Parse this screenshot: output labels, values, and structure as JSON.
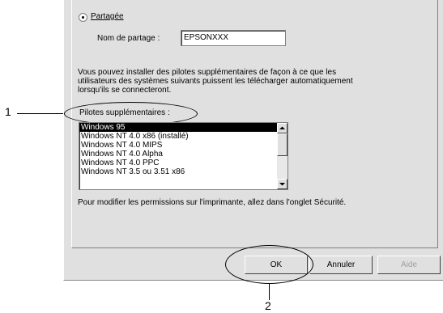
{
  "sharing": {
    "radio_label": "Partagée",
    "share_name_label": "Nom de partage :",
    "share_name_value": "EPSONXXX"
  },
  "info_text": {
    "line1": "Vous pouvez installer des pilotes supplémentaires de façon à ce que les",
    "line2": "utilisateurs des systèmes suivants puissent les télécharger automatiquement",
    "line3": "lorsqu'ils se connecteront."
  },
  "drivers": {
    "label": "Pilotes supplémentaires :",
    "items": [
      "Windows 95",
      "Windows NT 4.0 x86 (installé)",
      "Windows NT 4.0 MIPS",
      "Windows NT 4.0 Alpha",
      "Windows NT 4.0 PPC",
      "Windows NT 3.5 ou 3.51 x86"
    ]
  },
  "permissions_text": "Pour modifier les permissions sur l'imprimante, allez dans l'onglet Sécurité.",
  "buttons": {
    "ok": "OK",
    "cancel": "Annuler",
    "help": "Aide"
  },
  "callouts": {
    "one": "1",
    "two": "2"
  }
}
